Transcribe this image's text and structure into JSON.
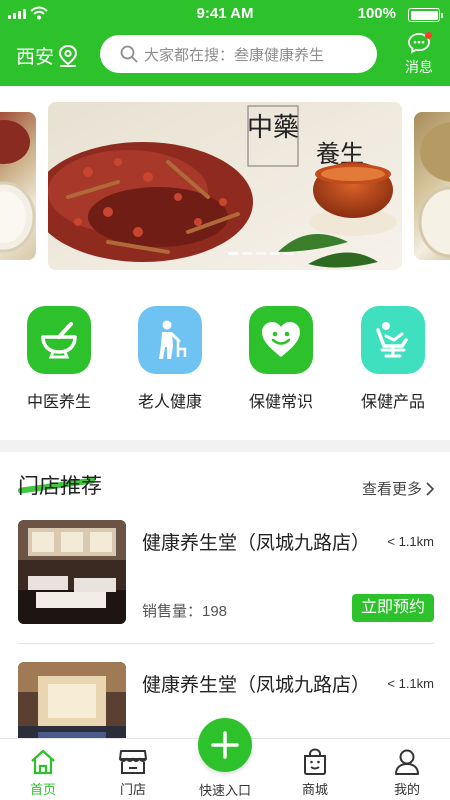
{
  "status_bar": {
    "time": "9:41 AM",
    "battery": "100%"
  },
  "header": {
    "city": "西安",
    "search_placeholder": "大家都在搜：叁康健康养生",
    "message_label": "消息"
  },
  "banner": {
    "text_top": "中藥",
    "text_bottom": "養生",
    "slides": 5,
    "active_slide": 1
  },
  "categories": [
    {
      "label": "中医养生",
      "icon": "mortar-pestle-icon",
      "color": "#2dc12c"
    },
    {
      "label": "老人健康",
      "icon": "elderly-person-icon",
      "color": "#6ec3f3"
    },
    {
      "label": "保健常识",
      "icon": "heart-smile-icon",
      "color": "#2dc12c"
    },
    {
      "label": "保健产品",
      "icon": "massage-chair-icon",
      "color": "#3ee0c0"
    }
  ],
  "stores_section": {
    "title": "门店推荐",
    "more": "查看更多"
  },
  "stores": [
    {
      "name": "健康养生堂（凤城九路店）",
      "distance": "< 1.1km",
      "sales": "销售量：198",
      "action": "立即预约"
    },
    {
      "name": "健康养生堂（凤城九路店）",
      "distance": "< 1.1km"
    }
  ],
  "tabbar": {
    "items": [
      {
        "label": "首页",
        "icon": "home-icon"
      },
      {
        "label": "门店",
        "icon": "store-icon"
      },
      {
        "label": "快速入口",
        "icon": "plus-icon"
      },
      {
        "label": "商城",
        "icon": "shopping-bag-icon"
      },
      {
        "label": "我的",
        "icon": "user-icon"
      }
    ],
    "active": "首页"
  },
  "colors": {
    "brand": "#2dc12c",
    "badge": "#ff3b30"
  }
}
